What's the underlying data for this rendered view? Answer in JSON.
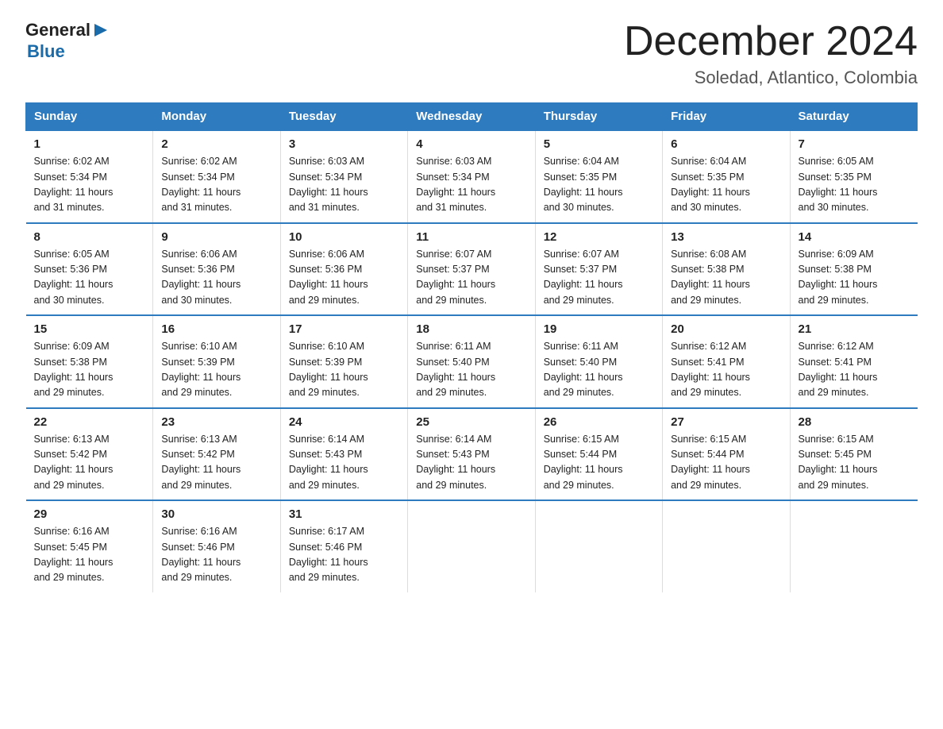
{
  "header": {
    "logo_general": "General",
    "logo_blue": "Blue",
    "month_title": "December 2024",
    "location": "Soledad, Atlantico, Colombia"
  },
  "days_of_week": [
    "Sunday",
    "Monday",
    "Tuesday",
    "Wednesday",
    "Thursday",
    "Friday",
    "Saturday"
  ],
  "weeks": [
    [
      {
        "day": "1",
        "sunrise": "6:02 AM",
        "sunset": "5:34 PM",
        "daylight": "11 hours and 31 minutes."
      },
      {
        "day": "2",
        "sunrise": "6:02 AM",
        "sunset": "5:34 PM",
        "daylight": "11 hours and 31 minutes."
      },
      {
        "day": "3",
        "sunrise": "6:03 AM",
        "sunset": "5:34 PM",
        "daylight": "11 hours and 31 minutes."
      },
      {
        "day": "4",
        "sunrise": "6:03 AM",
        "sunset": "5:34 PM",
        "daylight": "11 hours and 31 minutes."
      },
      {
        "day": "5",
        "sunrise": "6:04 AM",
        "sunset": "5:35 PM",
        "daylight": "11 hours and 30 minutes."
      },
      {
        "day": "6",
        "sunrise": "6:04 AM",
        "sunset": "5:35 PM",
        "daylight": "11 hours and 30 minutes."
      },
      {
        "day": "7",
        "sunrise": "6:05 AM",
        "sunset": "5:35 PM",
        "daylight": "11 hours and 30 minutes."
      }
    ],
    [
      {
        "day": "8",
        "sunrise": "6:05 AM",
        "sunset": "5:36 PM",
        "daylight": "11 hours and 30 minutes."
      },
      {
        "day": "9",
        "sunrise": "6:06 AM",
        "sunset": "5:36 PM",
        "daylight": "11 hours and 30 minutes."
      },
      {
        "day": "10",
        "sunrise": "6:06 AM",
        "sunset": "5:36 PM",
        "daylight": "11 hours and 29 minutes."
      },
      {
        "day": "11",
        "sunrise": "6:07 AM",
        "sunset": "5:37 PM",
        "daylight": "11 hours and 29 minutes."
      },
      {
        "day": "12",
        "sunrise": "6:07 AM",
        "sunset": "5:37 PM",
        "daylight": "11 hours and 29 minutes."
      },
      {
        "day": "13",
        "sunrise": "6:08 AM",
        "sunset": "5:38 PM",
        "daylight": "11 hours and 29 minutes."
      },
      {
        "day": "14",
        "sunrise": "6:09 AM",
        "sunset": "5:38 PM",
        "daylight": "11 hours and 29 minutes."
      }
    ],
    [
      {
        "day": "15",
        "sunrise": "6:09 AM",
        "sunset": "5:38 PM",
        "daylight": "11 hours and 29 minutes."
      },
      {
        "day": "16",
        "sunrise": "6:10 AM",
        "sunset": "5:39 PM",
        "daylight": "11 hours and 29 minutes."
      },
      {
        "day": "17",
        "sunrise": "6:10 AM",
        "sunset": "5:39 PM",
        "daylight": "11 hours and 29 minutes."
      },
      {
        "day": "18",
        "sunrise": "6:11 AM",
        "sunset": "5:40 PM",
        "daylight": "11 hours and 29 minutes."
      },
      {
        "day": "19",
        "sunrise": "6:11 AM",
        "sunset": "5:40 PM",
        "daylight": "11 hours and 29 minutes."
      },
      {
        "day": "20",
        "sunrise": "6:12 AM",
        "sunset": "5:41 PM",
        "daylight": "11 hours and 29 minutes."
      },
      {
        "day": "21",
        "sunrise": "6:12 AM",
        "sunset": "5:41 PM",
        "daylight": "11 hours and 29 minutes."
      }
    ],
    [
      {
        "day": "22",
        "sunrise": "6:13 AM",
        "sunset": "5:42 PM",
        "daylight": "11 hours and 29 minutes."
      },
      {
        "day": "23",
        "sunrise": "6:13 AM",
        "sunset": "5:42 PM",
        "daylight": "11 hours and 29 minutes."
      },
      {
        "day": "24",
        "sunrise": "6:14 AM",
        "sunset": "5:43 PM",
        "daylight": "11 hours and 29 minutes."
      },
      {
        "day": "25",
        "sunrise": "6:14 AM",
        "sunset": "5:43 PM",
        "daylight": "11 hours and 29 minutes."
      },
      {
        "day": "26",
        "sunrise": "6:15 AM",
        "sunset": "5:44 PM",
        "daylight": "11 hours and 29 minutes."
      },
      {
        "day": "27",
        "sunrise": "6:15 AM",
        "sunset": "5:44 PM",
        "daylight": "11 hours and 29 minutes."
      },
      {
        "day": "28",
        "sunrise": "6:15 AM",
        "sunset": "5:45 PM",
        "daylight": "11 hours and 29 minutes."
      }
    ],
    [
      {
        "day": "29",
        "sunrise": "6:16 AM",
        "sunset": "5:45 PM",
        "daylight": "11 hours and 29 minutes."
      },
      {
        "day": "30",
        "sunrise": "6:16 AM",
        "sunset": "5:46 PM",
        "daylight": "11 hours and 29 minutes."
      },
      {
        "day": "31",
        "sunrise": "6:17 AM",
        "sunset": "5:46 PM",
        "daylight": "11 hours and 29 minutes."
      },
      null,
      null,
      null,
      null
    ]
  ],
  "labels": {
    "sunrise_prefix": "Sunrise: ",
    "sunset_prefix": "Sunset: ",
    "daylight_prefix": "Daylight: "
  }
}
